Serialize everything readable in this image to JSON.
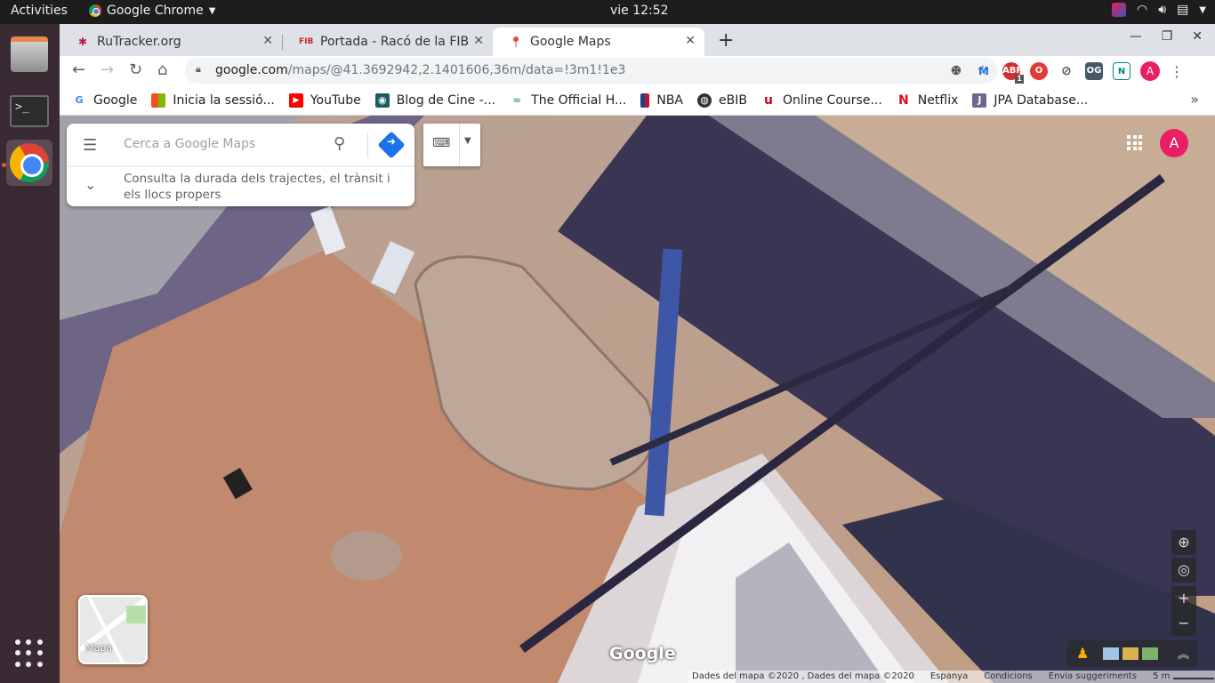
{
  "topbar": {
    "activities": "Activities",
    "app_name": "Google Chrome",
    "clock": "vie 12:52"
  },
  "dock": {
    "items": [
      "files-icon",
      "terminal-icon",
      "chrome-icon",
      "show-apps-icon"
    ]
  },
  "tabs": [
    {
      "title": "RuTracker.org",
      "icon": "rutracker-icon"
    },
    {
      "title": "Portada - Racó de la FIB",
      "icon": "fib-icon"
    },
    {
      "title": "Google Maps",
      "icon": "google-maps-icon",
      "active": true
    }
  ],
  "omnibox": {
    "host": "google.com",
    "path": "/maps/@41.3692942,2.1401606,36m/data=!3m1!1e3"
  },
  "extensions": {
    "adblock_count": "1",
    "avatar_letter": "A"
  },
  "bookmarks": [
    {
      "label": "Google",
      "color": "#4285f4",
      "glyph": "G"
    },
    {
      "label": "Inicia la sessió...",
      "color": "#f25022",
      "glyph": "■"
    },
    {
      "label": "YouTube",
      "color": "#ff0000",
      "glyph": "▶"
    },
    {
      "label": "Blog de Cine -...",
      "color": "#1c5b63",
      "glyph": "◉"
    },
    {
      "label": "The Official H...",
      "color": "#3aa757",
      "glyph": "∞"
    },
    {
      "label": "NBA",
      "color": "#1d428a",
      "glyph": "N"
    },
    {
      "label": "eBIB",
      "color": "#333333",
      "glyph": "◍"
    },
    {
      "label": "Online Course...",
      "color": "#d0021b",
      "glyph": "u"
    },
    {
      "label": "Netflix",
      "color": "#e50914",
      "glyph": "N"
    },
    {
      "label": "JPA Database...",
      "color": "#6b6b8f",
      "glyph": "J"
    }
  ],
  "maps": {
    "search_placeholder": "Cerca a Google Maps",
    "hint_text": "Consulta la durada dels trajectes, el trànsit i els llocs propers",
    "avatar_letter": "A",
    "layer_label": "Mapa",
    "logo": "Google",
    "attribution": {
      "data": "Dades del mapa ©2020 , Dades del mapa ©2020",
      "country": "Espanya",
      "terms": "Condicions",
      "feedback": "Envia suggeriments",
      "scale": "5 m"
    }
  }
}
